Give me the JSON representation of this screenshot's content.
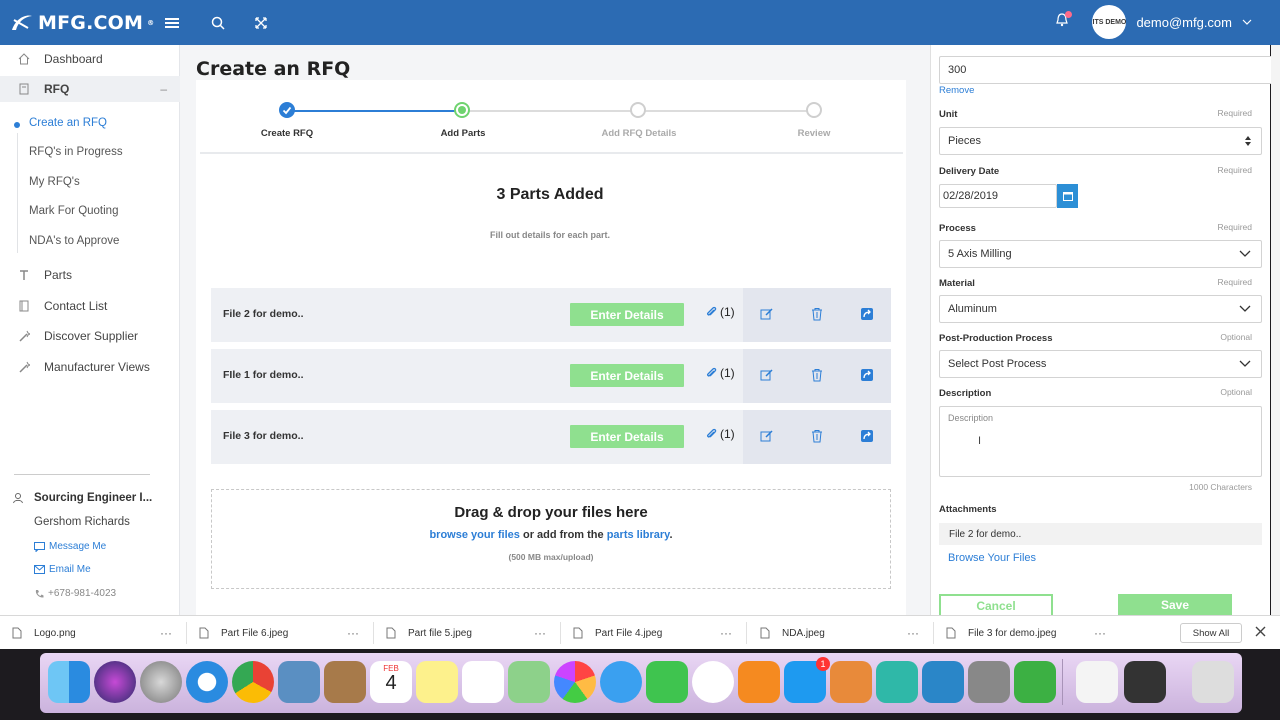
{
  "header": {
    "logo": "MFG.COM",
    "logo_mark": "®",
    "user_email": "demo@mfg.com",
    "avatar_text": "ITS DEMO"
  },
  "sidebar": {
    "items": [
      {
        "label": "Dashboard",
        "icon": "home-icon"
      },
      {
        "label": "RFQ",
        "icon": "document-icon",
        "toggle": "–"
      },
      {
        "label": "Parts",
        "icon": "tool-icon"
      },
      {
        "label": "Contact List",
        "icon": "book-icon"
      },
      {
        "label": "Discover Supplier",
        "icon": "wand-icon"
      },
      {
        "label": "Manufacturer Views",
        "icon": "wand-icon"
      }
    ],
    "rfq_sub": [
      "Create an RFQ",
      "RFQ's in Progress",
      "My RFQ's",
      "Mark For Quoting",
      "NDA's to Approve"
    ],
    "contact": {
      "role": "Sourcing Engineer I...",
      "name": "Gershom Richards",
      "message": "Message Me",
      "email": "Email Me",
      "phone": "+678-981-4023"
    }
  },
  "main": {
    "title": "Create an RFQ",
    "steps": [
      {
        "label": "Create RFQ",
        "state": "done"
      },
      {
        "label": "Add Parts",
        "state": "current"
      },
      {
        "label": "Add RFQ Details",
        "state": "pending"
      },
      {
        "label": "Review",
        "state": "pending"
      }
    ],
    "parts_title": "3 Parts Added",
    "parts_subtitle": "Fill out details for each part.",
    "parts": [
      {
        "name": "File 2 for demo..",
        "button": "Enter Details",
        "attachments": "(1)"
      },
      {
        "name": "FIle 1 for demo..",
        "button": "Enter Details",
        "attachments": "(1)"
      },
      {
        "name": "File 3 for demo..",
        "button": "Enter Details",
        "attachments": "(1)"
      }
    ],
    "dropzone": {
      "title": "Drag & drop your files here",
      "browse": "browse your files",
      "or_text": " or add from the ",
      "library": "parts library",
      "period": ".",
      "limit": "(500 MB max/upload)"
    }
  },
  "detail_panel": {
    "quantity_value": "300",
    "remove": "Remove",
    "unit_label": "Unit",
    "unit_req": "Required",
    "unit_value": "Pieces",
    "date_label": "Delivery Date",
    "date_req": "Required",
    "date_value": "02/28/2019",
    "process_label": "Process",
    "process_req": "Required",
    "process_value": "5 Axis Milling",
    "material_label": "Material",
    "material_req": "Required",
    "material_value": "Aluminum",
    "post_label": "Post-Production Process",
    "post_req": "Optional",
    "post_value": "Select Post Process",
    "desc_label": "Description",
    "desc_req": "Optional",
    "desc_placeholder": "Description",
    "char_limit": "1000 Characters",
    "attach_label": "Attachments",
    "attach_file": "File 2 for demo..",
    "browse": "Browse Your Files",
    "cancel": "Cancel",
    "save": "Save"
  },
  "downloads": {
    "files": [
      "Logo.png",
      "Part File 6.jpeg",
      "Part file 5.jpeg",
      "Part File 4.jpeg",
      "NDA.jpeg",
      "File 3 for demo.jpeg"
    ],
    "show_all": "Show All"
  },
  "dock": {
    "calendar_month": "FEB",
    "calendar_day": "4",
    "appstore_badge": "1"
  },
  "colors": {
    "header": "#2c6bb3",
    "accent": "#2c7ed6",
    "step_done": "#2c7ed6",
    "step_current": "#6fd36f",
    "enter_button": "#8fe08f"
  }
}
